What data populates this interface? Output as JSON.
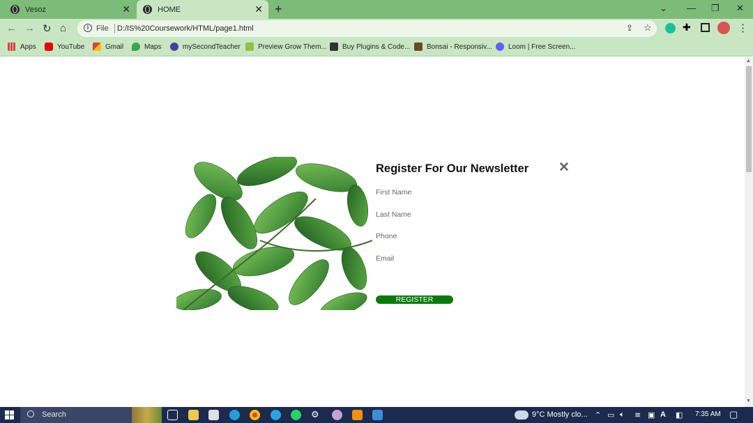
{
  "browser": {
    "tabs": [
      {
        "label": "Vesoz",
        "active": false
      },
      {
        "label": "HOME",
        "active": true
      }
    ],
    "address": {
      "scheme_label": "File",
      "url": "D:/IS%20Coursework/HTML/page1.html"
    },
    "bookmarks": [
      {
        "label": "Apps",
        "icon": "apps-grid-icon",
        "color": "#d64541"
      },
      {
        "label": "YouTube",
        "icon": "youtube-icon",
        "color": "#e60000"
      },
      {
        "label": "Gmail",
        "icon": "gmail-icon",
        "color": "#d44638"
      },
      {
        "label": "Maps",
        "icon": "maps-pin-icon",
        "color": "#34a853"
      },
      {
        "label": "mySecondTeacher",
        "icon": "mysecondteacher-icon",
        "color": "#4a3e9c"
      },
      {
        "label": "Preview Grow Them...",
        "icon": "shopify-icon",
        "color": "#95bf47"
      },
      {
        "label": "Buy Plugins & Code...",
        "icon": "codecanyon-icon",
        "color": "#333333"
      },
      {
        "label": "Bonsai - Responsiv...",
        "icon": "bonsai-icon",
        "color": "#6b4a2a"
      },
      {
        "label": "Loom | Free Screen...",
        "icon": "loom-icon",
        "color": "#625df5"
      }
    ]
  },
  "modal": {
    "title": "Register For Our Newsletter",
    "close_symbol": "✕",
    "fields": [
      {
        "placeholder": "First Name"
      },
      {
        "placeholder": "Last Name"
      },
      {
        "placeholder": "Phone"
      },
      {
        "placeholder": "Email"
      }
    ],
    "register_label": "REGISTER",
    "button_color": "#0a7a0a"
  },
  "taskbar": {
    "search_label": "Search",
    "weather": "9°C  Mostly clo...",
    "time": "7:35 AM"
  }
}
